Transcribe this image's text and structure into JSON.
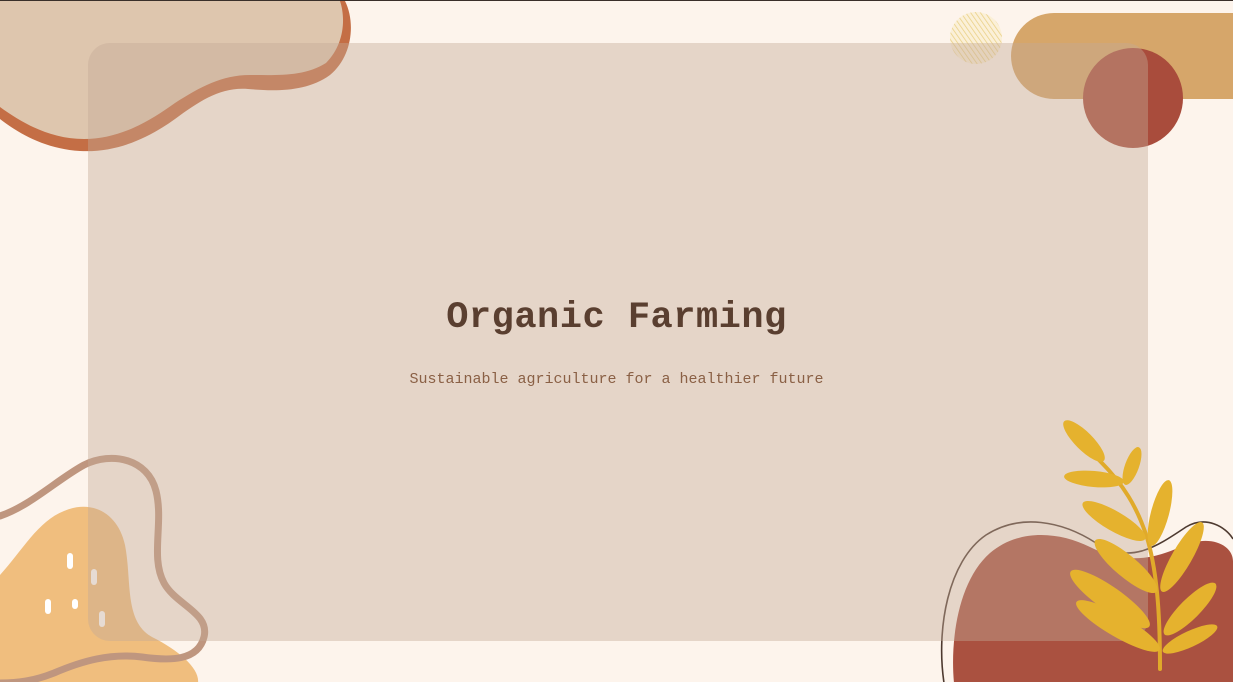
{
  "slide": {
    "title": "Organic Farming",
    "subtitle": "Sustainable agriculture for a healthier future"
  },
  "colors": {
    "background": "#FDF4EC",
    "card": "#E3D6CC",
    "title_text": "#5A3F30",
    "subtitle_text": "#8A6045",
    "terracotta": "#C46E45",
    "sand": "#DEC6AE",
    "mustard": "#D6A66A",
    "rust": "#A24A3A",
    "peach": "#F0BE7E",
    "taupe": "#BF967F",
    "leaf": "#E5B22E"
  }
}
